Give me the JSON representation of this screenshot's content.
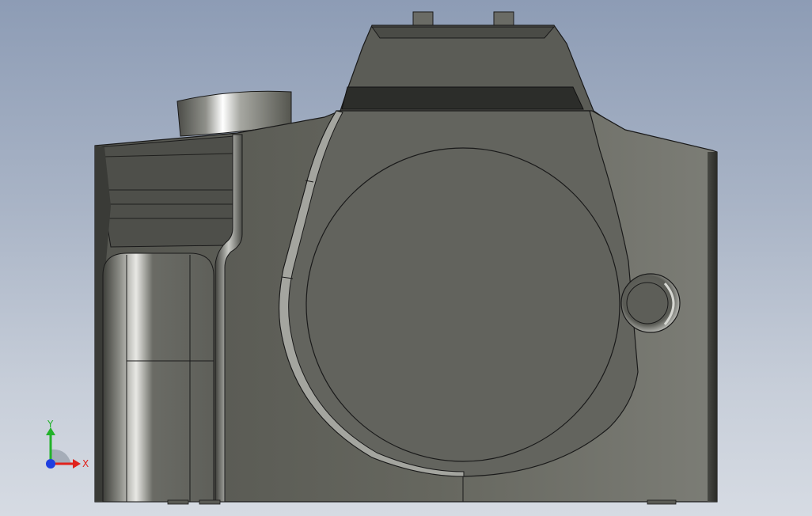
{
  "viewport": {
    "background_top": "#8d9cb5",
    "background_bottom": "#d6dbe3"
  },
  "model": {
    "body_color": "#66675f",
    "edge_color": "#1a1a1a",
    "prism_color": "#5a5b55",
    "prism_band_color": "#2b2c29"
  },
  "triad": {
    "x_label": "X",
    "y_label": "Y",
    "x_color": "#e0221c",
    "y_color": "#22b22a",
    "z_color": "#1f3fe0"
  }
}
